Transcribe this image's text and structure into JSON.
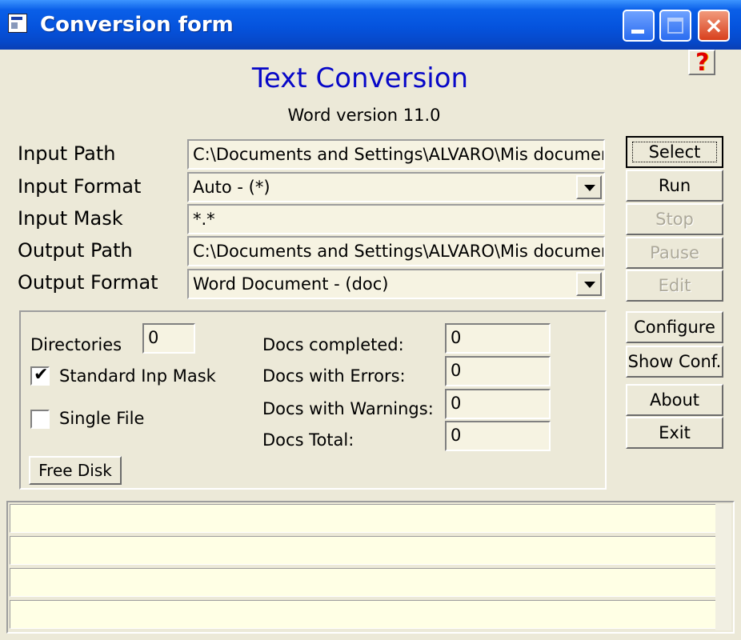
{
  "window": {
    "title": "Conversion form",
    "controls": {
      "minimize": "minimize-icon",
      "maximize": "maximize-icon",
      "close": "×"
    }
  },
  "help_button": "?",
  "header": {
    "title": "Text Conversion",
    "subtitle": "Word version 11.0"
  },
  "form": {
    "input_path": {
      "label": "Input Path",
      "value": "C:\\Documents and Settings\\ALVARO\\Mis documen"
    },
    "input_format": {
      "label": "Input Format",
      "value": "Auto - (*)"
    },
    "input_mask": {
      "label": "Input Mask",
      "value": "*.*"
    },
    "output_path": {
      "label": "Output Path",
      "value": "C:\\Documents and Settings\\ALVARO\\Mis documen"
    },
    "output_format": {
      "label": "Output Format",
      "value": "Word Document - (doc)"
    }
  },
  "buttons": {
    "select": "Select",
    "run": "Run",
    "stop": "Stop",
    "pause": "Pause",
    "edit": "Edit",
    "configure": "Configure",
    "show_conf": "Show Conf.",
    "about": "About",
    "exit": "Exit"
  },
  "stats": {
    "directories": {
      "label": "Directories",
      "value": "0"
    },
    "standard_inp_mask": {
      "label": "Standard Inp Mask",
      "checked": true,
      "mark": "✔"
    },
    "single_file": {
      "label": "Single File",
      "checked": false
    },
    "free_disk": "Free Disk",
    "docs_completed": {
      "label": "Docs completed:",
      "value": "0"
    },
    "docs_errors": {
      "label": "Docs with Errors:",
      "value": "0"
    },
    "docs_warnings": {
      "label": "Docs with Warnings:",
      "value": "0"
    },
    "docs_total": {
      "label": "Docs Total:",
      "value": "0"
    }
  },
  "log_lines": [
    "",
    "",
    "",
    ""
  ],
  "colors": {
    "titlebar": "#0553dd",
    "heading": "#0808c8",
    "field_bg": "#f6f3e2",
    "log_bg": "#ffffe5",
    "window_bg": "#ece9d8"
  }
}
